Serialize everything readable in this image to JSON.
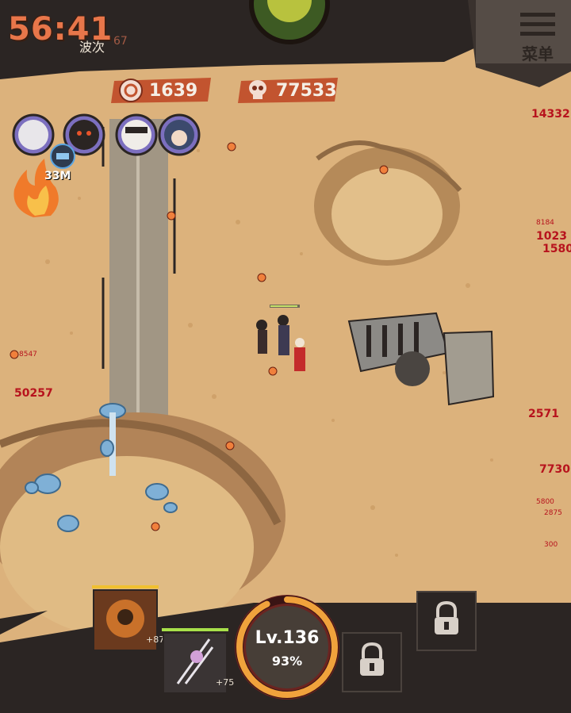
{
  "hud": {
    "timer": "56:41",
    "wave_label": "波次",
    "wave_number": "67",
    "menu_label": "菜单"
  },
  "resources": {
    "coins": "1639",
    "kills": "77533"
  },
  "player": {
    "level_label": "Lv.136",
    "xp_percent": "93%",
    "xp_fraction": 0.93
  },
  "boost": {
    "label": "33M"
  },
  "skills": [
    {
      "name": "skill-1",
      "count": "+87"
    },
    {
      "name": "skill-2",
      "count": "+75"
    }
  ],
  "damage_numbers": [
    "14332",
    "8184",
    "1023",
    "1580",
    "8547",
    "50257",
    "2571",
    "7730",
    "5800",
    "2875",
    "300"
  ],
  "colors": {
    "sand": "#dcb27c",
    "timer": "#e8764a",
    "damage": "#b7131d",
    "dark_frame": "#2b2523",
    "pill": "#c2542f"
  }
}
